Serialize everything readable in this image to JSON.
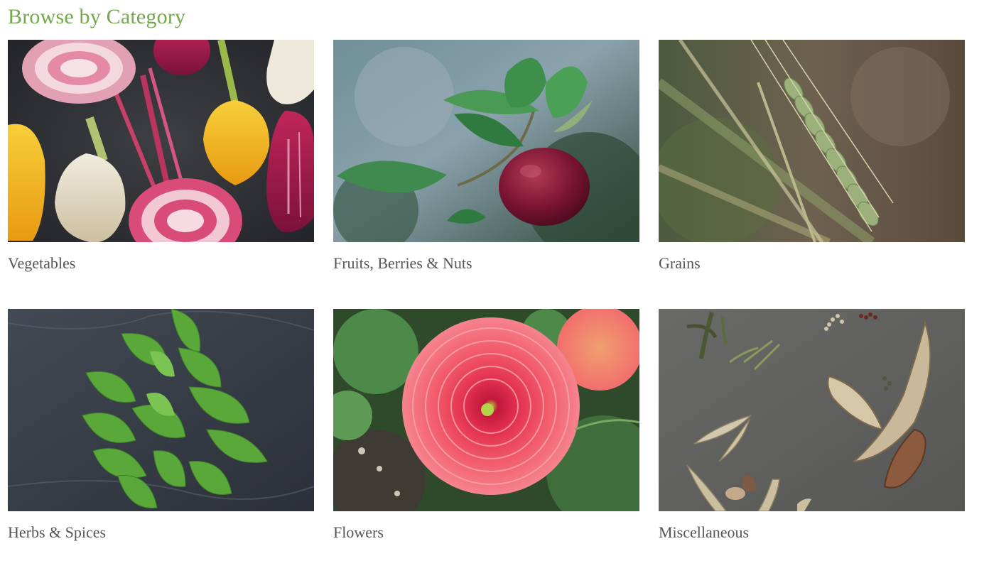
{
  "heading": "Browse by Category",
  "colors": {
    "heading": "#74a84a",
    "label": "#555555"
  },
  "categories": [
    {
      "label": "Vegetables",
      "image": "beets-photo"
    },
    {
      "label": "Fruits, Berries & Nuts",
      "image": "apple-branch-photo"
    },
    {
      "label": "Grains",
      "image": "wheat-photo"
    },
    {
      "label": "Herbs & Spices",
      "image": "basil-photo"
    },
    {
      "label": "Flowers",
      "image": "dahlia-photo"
    },
    {
      "label": "Miscellaneous",
      "image": "seed-pods-photo"
    }
  ]
}
